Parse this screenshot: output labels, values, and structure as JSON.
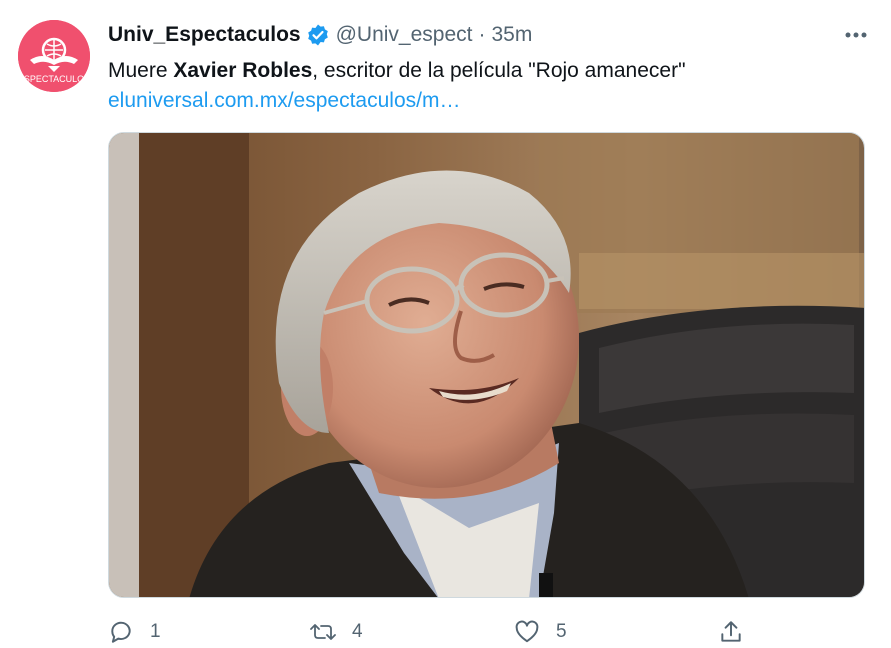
{
  "tweet": {
    "display_name": "Univ_Espectaculos",
    "handle": "@Univ_espect",
    "separator": "·",
    "time": "35m",
    "verified_icon": "verified-badge-icon",
    "avatar_text": "ESPECTACULOS",
    "text_prefix": "Muere ",
    "text_bold": "Xavier Robles",
    "text_suffix": ", escritor de la película \"Rojo amanecer\"",
    "link": "eluniversal.com.mx/espectaculos/m…",
    "media_alt": "Photo of a smiling older man with glasses"
  },
  "actions": {
    "reply_count": "1",
    "retweet_count": "4",
    "like_count": "5"
  },
  "colors": {
    "accent": "#1d9bf0",
    "avatar_bg": "#f0506e",
    "secondary_text": "#536471"
  }
}
